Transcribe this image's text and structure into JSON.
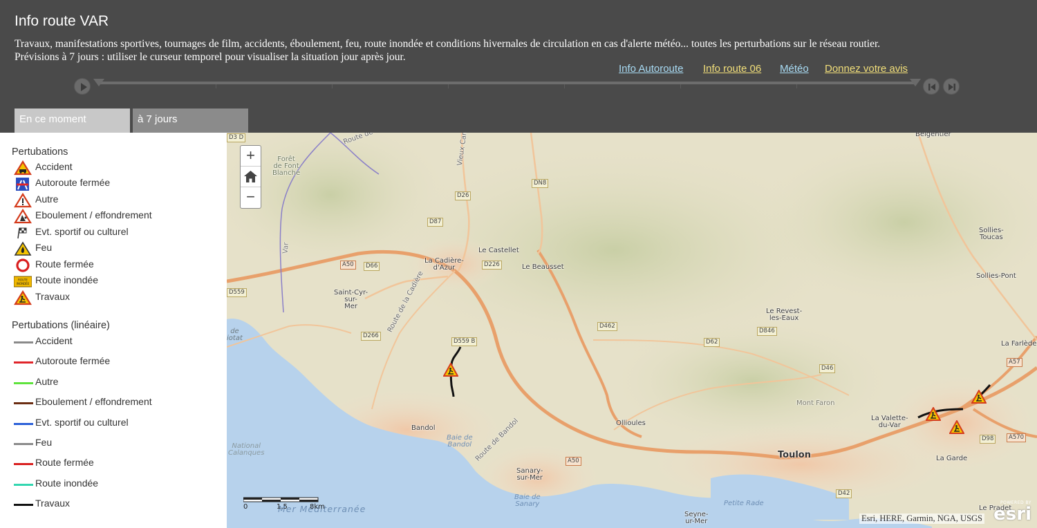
{
  "header": {
    "title": "Info route VAR",
    "description": "Travaux, manifestations sportives, tournages de film, accidents, éboulement, feu, route inondée et conditions hivernales de circulation en cas d'alerte météo... toutes les perturbations sur le réseau routier. Prévisions à 7 jours : utiliser le curseur temporel pour visualiser la situation jour après jour.",
    "links": [
      {
        "label": "Info Autoroute",
        "color": "#a9dcf5"
      },
      {
        "label": "Info route 06",
        "color": "#f2df7a"
      },
      {
        "label": "Météo",
        "color": "#a9dcf5"
      },
      {
        "label": "Donnez votre avis",
        "color": "#f2df7a"
      }
    ]
  },
  "timeline": {
    "play_icon": "play-icon",
    "prev_icon": "skip-back-icon",
    "next_icon": "skip-forward-icon"
  },
  "tabs": [
    {
      "label": "En ce moment",
      "active": true
    },
    {
      "label": "à 7 jours",
      "active": false
    }
  ],
  "legend": {
    "points_title": "Pertubations",
    "points": [
      {
        "label": "Accident",
        "icon": "accident-icon"
      },
      {
        "label": "Autoroute fermée",
        "icon": "highway-closed-icon"
      },
      {
        "label": "Autre",
        "icon": "warning-icon"
      },
      {
        "label": "Eboulement / effondrement",
        "icon": "landslide-icon"
      },
      {
        "label": "Evt. sportif ou culturel",
        "icon": "race-flag-icon"
      },
      {
        "label": "Feu",
        "icon": "fire-icon"
      },
      {
        "label": "Route fermée",
        "icon": "road-closed-icon"
      },
      {
        "label": "Route inondée",
        "icon": "flooded-road-icon",
        "sign_text": "ROUTE INONDÉE"
      },
      {
        "label": "Travaux",
        "icon": "roadworks-icon"
      }
    ],
    "lines_title": "Pertubations (linéaire)",
    "lines": [
      {
        "label": "Accident",
        "color": "#8a8a8a"
      },
      {
        "label": "Autoroute fermée",
        "color": "#e0252a"
      },
      {
        "label": "Autre",
        "color": "#5ee33c"
      },
      {
        "label": "Eboulement / effondrement",
        "color": "#6b2d12"
      },
      {
        "label": "Evt. sportif ou culturel",
        "color": "#2a5fd8"
      },
      {
        "label": "Feu",
        "color": "#8a8a8a"
      },
      {
        "label": "Route fermée",
        "color": "#d91f1f"
      },
      {
        "label": "Route inondée",
        "color": "#33d6b0"
      },
      {
        "label": "Travaux",
        "color": "#111111"
      }
    ]
  },
  "map": {
    "zoom_in": "+",
    "zoom_out": "−",
    "home_icon": "home-icon",
    "places": [
      {
        "label": "Belgentier"
      },
      {
        "label": "Forêt\nde Font\nBlanche"
      },
      {
        "label": "Le Castellet"
      },
      {
        "label": "La Cadière-\nd'Azur"
      },
      {
        "label": "Le Beausset"
      },
      {
        "label": "Saint-Cyr-\nsur-\nMer"
      },
      {
        "label": "Sollies-\nToucas"
      },
      {
        "label": "Sollies-Pont"
      },
      {
        "label": "Le Revest-\nles-Eaux"
      },
      {
        "label": "La Farlède"
      },
      {
        "label": "Mont Faron"
      },
      {
        "label": "La Valette-\ndu-Var"
      },
      {
        "label": "Ollioules"
      },
      {
        "label": "Bandol"
      },
      {
        "label": "La Garde"
      },
      {
        "label": "Toulon",
        "big": true
      },
      {
        "label": "Sanary-\nsur-Mer"
      },
      {
        "label": "Le Pradet"
      },
      {
        "label": "Seyne-\nur-Mer"
      }
    ],
    "water_labels": [
      {
        "label": "Baie de\nBandol"
      },
      {
        "label": "National\nCalanques"
      },
      {
        "label": "Baie de\nSanary"
      },
      {
        "label": "Petite Rade"
      },
      {
        "label": "Mer Méditerranée"
      },
      {
        "label": "de\niotat"
      }
    ],
    "road_shields": [
      {
        "label": "D3 D"
      },
      {
        "label": "DN8"
      },
      {
        "label": "D26"
      },
      {
        "label": "D87"
      },
      {
        "label": "A50",
        "type": "a"
      },
      {
        "label": "D66"
      },
      {
        "label": "D226"
      },
      {
        "label": "D559"
      },
      {
        "label": "D266"
      },
      {
        "label": "D559 B"
      },
      {
        "label": "D462"
      },
      {
        "label": "D846"
      },
      {
        "label": "D62"
      },
      {
        "label": "D46"
      },
      {
        "label": "A57",
        "type": "a"
      },
      {
        "label": "D98"
      },
      {
        "label": "A570",
        "type": "a"
      },
      {
        "label": "A50",
        "type": "a"
      },
      {
        "label": "D42"
      }
    ],
    "road_labels": [
      {
        "label": "Route de"
      },
      {
        "label": "Route de la Cadière"
      },
      {
        "label": "Vieux Camp"
      },
      {
        "label": "Var"
      },
      {
        "label": "Route de Bandol"
      }
    ],
    "scale": {
      "zero": "0",
      "mid": "1.5",
      "end": "8km"
    },
    "attribution": "Esri, HERE, Garmin, NGA, USGS",
    "esri_powered": "POWERED BY",
    "esri_brand": "esri",
    "incidents": [
      {
        "type": "roadworks"
      },
      {
        "type": "roadworks"
      },
      {
        "type": "roadworks"
      },
      {
        "type": "roadworks"
      }
    ]
  }
}
